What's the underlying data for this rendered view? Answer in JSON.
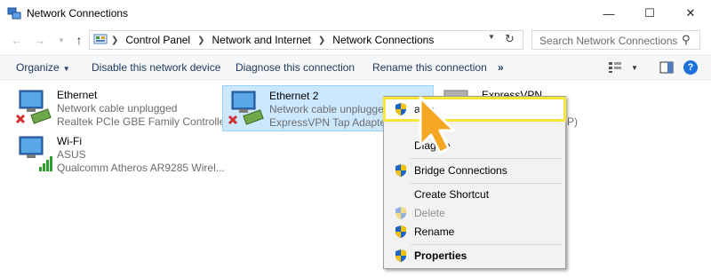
{
  "window": {
    "title": "Network Connections",
    "controls": {
      "minimize": "—",
      "maximize": "☐",
      "close": "✕"
    }
  },
  "address": {
    "breadcrumbs": [
      "Control Panel",
      "Network and Internet",
      "Network Connections"
    ],
    "search_placeholder": "Search Network Connections"
  },
  "commands": {
    "organize": "Organize",
    "disable": "Disable this network device",
    "diagnose": "Diagnose this connection",
    "rename": "Rename this connection",
    "more": "»"
  },
  "connections": [
    {
      "name": "Ethernet",
      "status": "Network cable unplugged",
      "device": "Realtek PCIe GBE Family Controller",
      "state": "disconnected"
    },
    {
      "name": "Ethernet 2",
      "status": "Network cable unplugged",
      "device": "ExpressVPN Tap Adapter",
      "state": "disconnected",
      "selected": true
    },
    {
      "name": "ExpressVPN",
      "status": "",
      "device": "P)",
      "state": "partially-hidden"
    },
    {
      "name": "Wi-Fi",
      "status": "ASUS",
      "device": "Qualcomm Atheros AR9285 Wirel...",
      "state": "connected"
    }
  ],
  "context_menu": {
    "items": [
      {
        "label": "able",
        "shield": true,
        "highlighted": true
      },
      {
        "label": "Diag  se",
        "shield": false
      },
      {
        "label": "Bridge Connections",
        "shield": true
      },
      {
        "label": "Create Shortcut",
        "shield": false
      },
      {
        "label": "Delete",
        "shield": true,
        "disabled": true
      },
      {
        "label": "Rename",
        "shield": true
      },
      {
        "label": "Properties",
        "shield": true,
        "bold": true
      }
    ]
  },
  "colors": {
    "selection": "#cce8ff",
    "highlight_outline": "#f7e53a",
    "cursor_fill": "#f5a623",
    "link_text": "#1e395b",
    "help": "#1a6fd9",
    "error_x": "#d32f2f"
  }
}
